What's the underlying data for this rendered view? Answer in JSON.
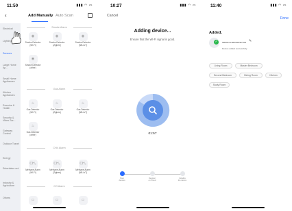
{
  "phone1": {
    "status_time": "11:50",
    "status_icons": "▮▮▮ ◠ ▭",
    "nav": {
      "back": "‹",
      "tab_manual": "Add Manually",
      "tab_auto": "Auto Scan"
    },
    "sidebar": [
      "Electrical",
      "Lighting",
      "Sensors",
      "Large\nHome Ap...",
      "Small Home\nAppliances",
      "Kitchen\nAppliances",
      "Exercise\n& Health",
      "Security &\nVideo Sur...",
      "Gateway\nControl",
      "Outdoor\nTravel",
      "Energy",
      "Entertainm\nent",
      "Industry &\nAgriculture",
      "Others"
    ],
    "sections": [
      "Smoke Alarm",
      "Gas Alarm",
      "CH4 Alarm",
      "CO Alarm"
    ],
    "smoke_devices": [
      "Smoke Detector\n(Wi-Fi)",
      "Smoke Detector\n(Zigbee)",
      "Smoke Detector\n(NB-IoT)",
      "Smoke Detector\n(other)"
    ],
    "gas_devices": [
      "Gas Detector\n(Wi-Fi)",
      "Gas Detector\n(Zigbee)",
      "Gas Detector\n(NB-IoT)",
      "Gas Detector\n(other)"
    ],
    "ch4_devices": [
      "Methane Alarm\n(Wi-Fi)",
      "Methane Alarm\n(Zigbee)",
      "Methane Alarm\n(NB-IoT)"
    ],
    "ch4_icon_text": "CH₄"
  },
  "phone2": {
    "status_time": "10:27",
    "status_icons": "▮▮▮ ◠ ▭",
    "cancel": "Cancel",
    "title": "Adding device...",
    "subtitle": "Ensure that the Wi-Fi signal is good.",
    "timer": "01:57",
    "steps": [
      "Scan\ndevices",
      "Register\non Cloud",
      "Initialize\nthe device"
    ]
  },
  "phone3": {
    "status_time": "11:40",
    "status_icons": "▮▮▮ ◠ ▭",
    "done": "Done",
    "added": "Added.",
    "device_name": "SMOKE ALARM DETECTOR",
    "edit_icon": "✎",
    "success": "Device added successfully",
    "rooms": [
      "Living Room",
      "Master Bedroom",
      "Second Bedroom",
      "Dining Room",
      "Kitchen",
      "Study Room"
    ]
  },
  "colors": {
    "accent": "#2a6cff",
    "success": "#29b84c",
    "ring_outer": "#c9daf8",
    "ring_inner": "#5b8fe6"
  },
  "icons": {
    "scan": "scan-icon",
    "back": "back-chevron-icon",
    "search": "search-icon",
    "check": "check-icon",
    "edit": "edit-pencil-icon"
  }
}
